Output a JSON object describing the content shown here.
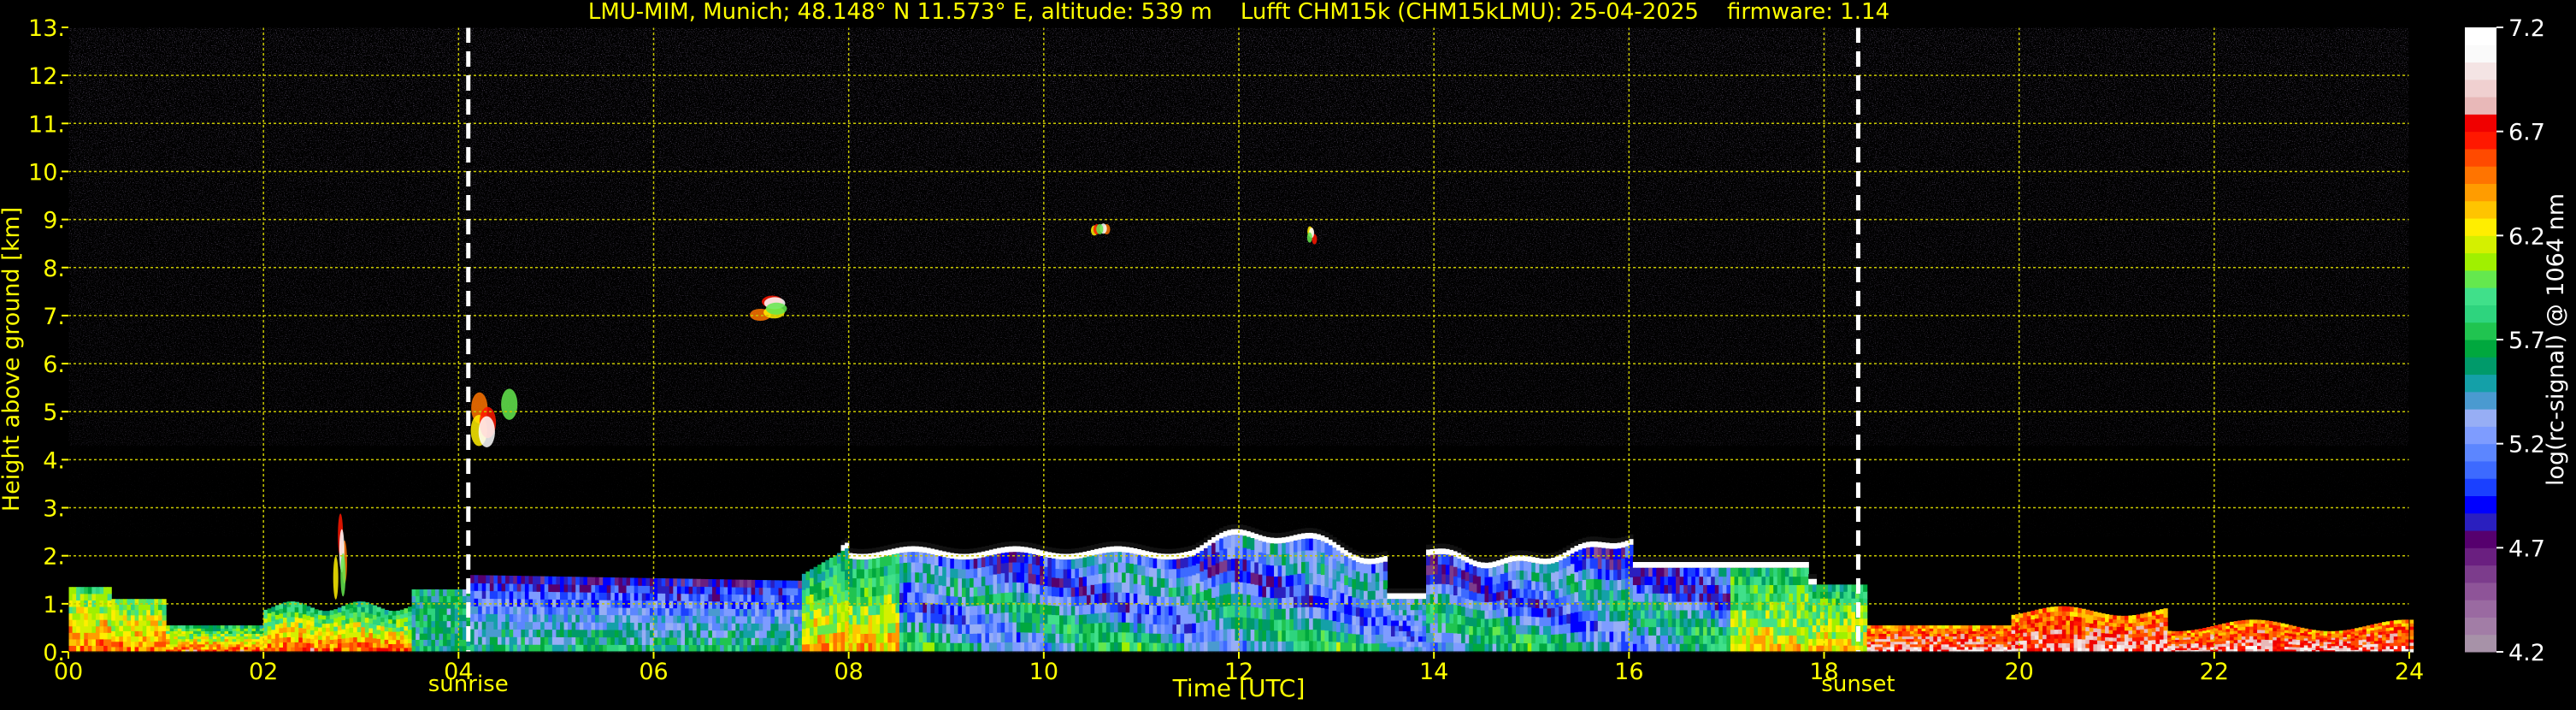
{
  "chart_data": {
    "type": "heatmap",
    "title": "LMU-MIM, Munich; 48.148° N 11.573° E, altitude: 539 m    Lufft CHM15k (CHM15kLMU): 25-04-2025    firmware: 1.14",
    "xlabel": "Time [UTC]",
    "ylabel": "Height above ground [km]",
    "xlim": [
      0,
      24
    ],
    "ylim": [
      0,
      13
    ],
    "x_ticks": [
      "00",
      "02",
      "04",
      "06",
      "08",
      "10",
      "12",
      "14",
      "16",
      "18",
      "20",
      "22",
      "24"
    ],
    "y_ticks": [
      "0.",
      "1.",
      "2.",
      "3.",
      "4.",
      "5.",
      "6.",
      "7.",
      "8.",
      "9.",
      "10.",
      "11.",
      "12.",
      "13."
    ],
    "grid": true,
    "markers": [
      {
        "label": "sunrise",
        "x": 4.1
      },
      {
        "label": "sunset",
        "x": 18.35
      }
    ],
    "colorbar": {
      "label": "log(rc-signal) @ 1064 nm",
      "min": 4.2,
      "max": 7.2,
      "ticks": [
        "4.2",
        "4.7",
        "5.2",
        "5.7",
        "6.2",
        "6.7",
        "7.2"
      ],
      "colors": [
        "#a792a8",
        "#a27da6",
        "#9a6aa1",
        "#8e5498",
        "#7c3c8c",
        "#6a1f80",
        "#56006e",
        "#2a1fbf",
        "#0000ff",
        "#1a40ff",
        "#3d6aff",
        "#5c86ff",
        "#7e9cff",
        "#97aef5",
        "#4a9ad0",
        "#14a0a8",
        "#009a6a",
        "#00a83e",
        "#20c450",
        "#2ed47e",
        "#40e08a",
        "#64e84e",
        "#a0f000",
        "#d4f000",
        "#ffee00",
        "#ffc400",
        "#ff9c00",
        "#ff7400",
        "#ff4a00",
        "#ff1800",
        "#f00000",
        "#e8b8b8",
        "#f0d0d0",
        "#f4e4e4",
        "#fafafa",
        "#ffffff"
      ]
    },
    "features": [
      {
        "name": "boundary layer aerosol",
        "x_range": [
          0,
          24
        ],
        "y_range": [
          0,
          2.5
        ]
      },
      {
        "name": "cloud",
        "x_range": [
          4.1,
          4.8
        ],
        "y_range": [
          4.3,
          5.6
        ]
      },
      {
        "name": "cloud",
        "x_range": [
          6.5,
          7.4
        ],
        "y_range": [
          6.9,
          7.4
        ]
      },
      {
        "name": "cloud",
        "x_range": [
          10.4,
          10.7
        ],
        "y_range": [
          8.6,
          8.9
        ]
      },
      {
        "name": "cloud",
        "x_range": [
          12.7,
          12.8
        ],
        "y_range": [
          8.5,
          8.9
        ]
      },
      {
        "name": "cloud",
        "x_range": [
          2.7,
          2.9
        ],
        "y_range": [
          1.0,
          2.8
        ]
      }
    ]
  }
}
